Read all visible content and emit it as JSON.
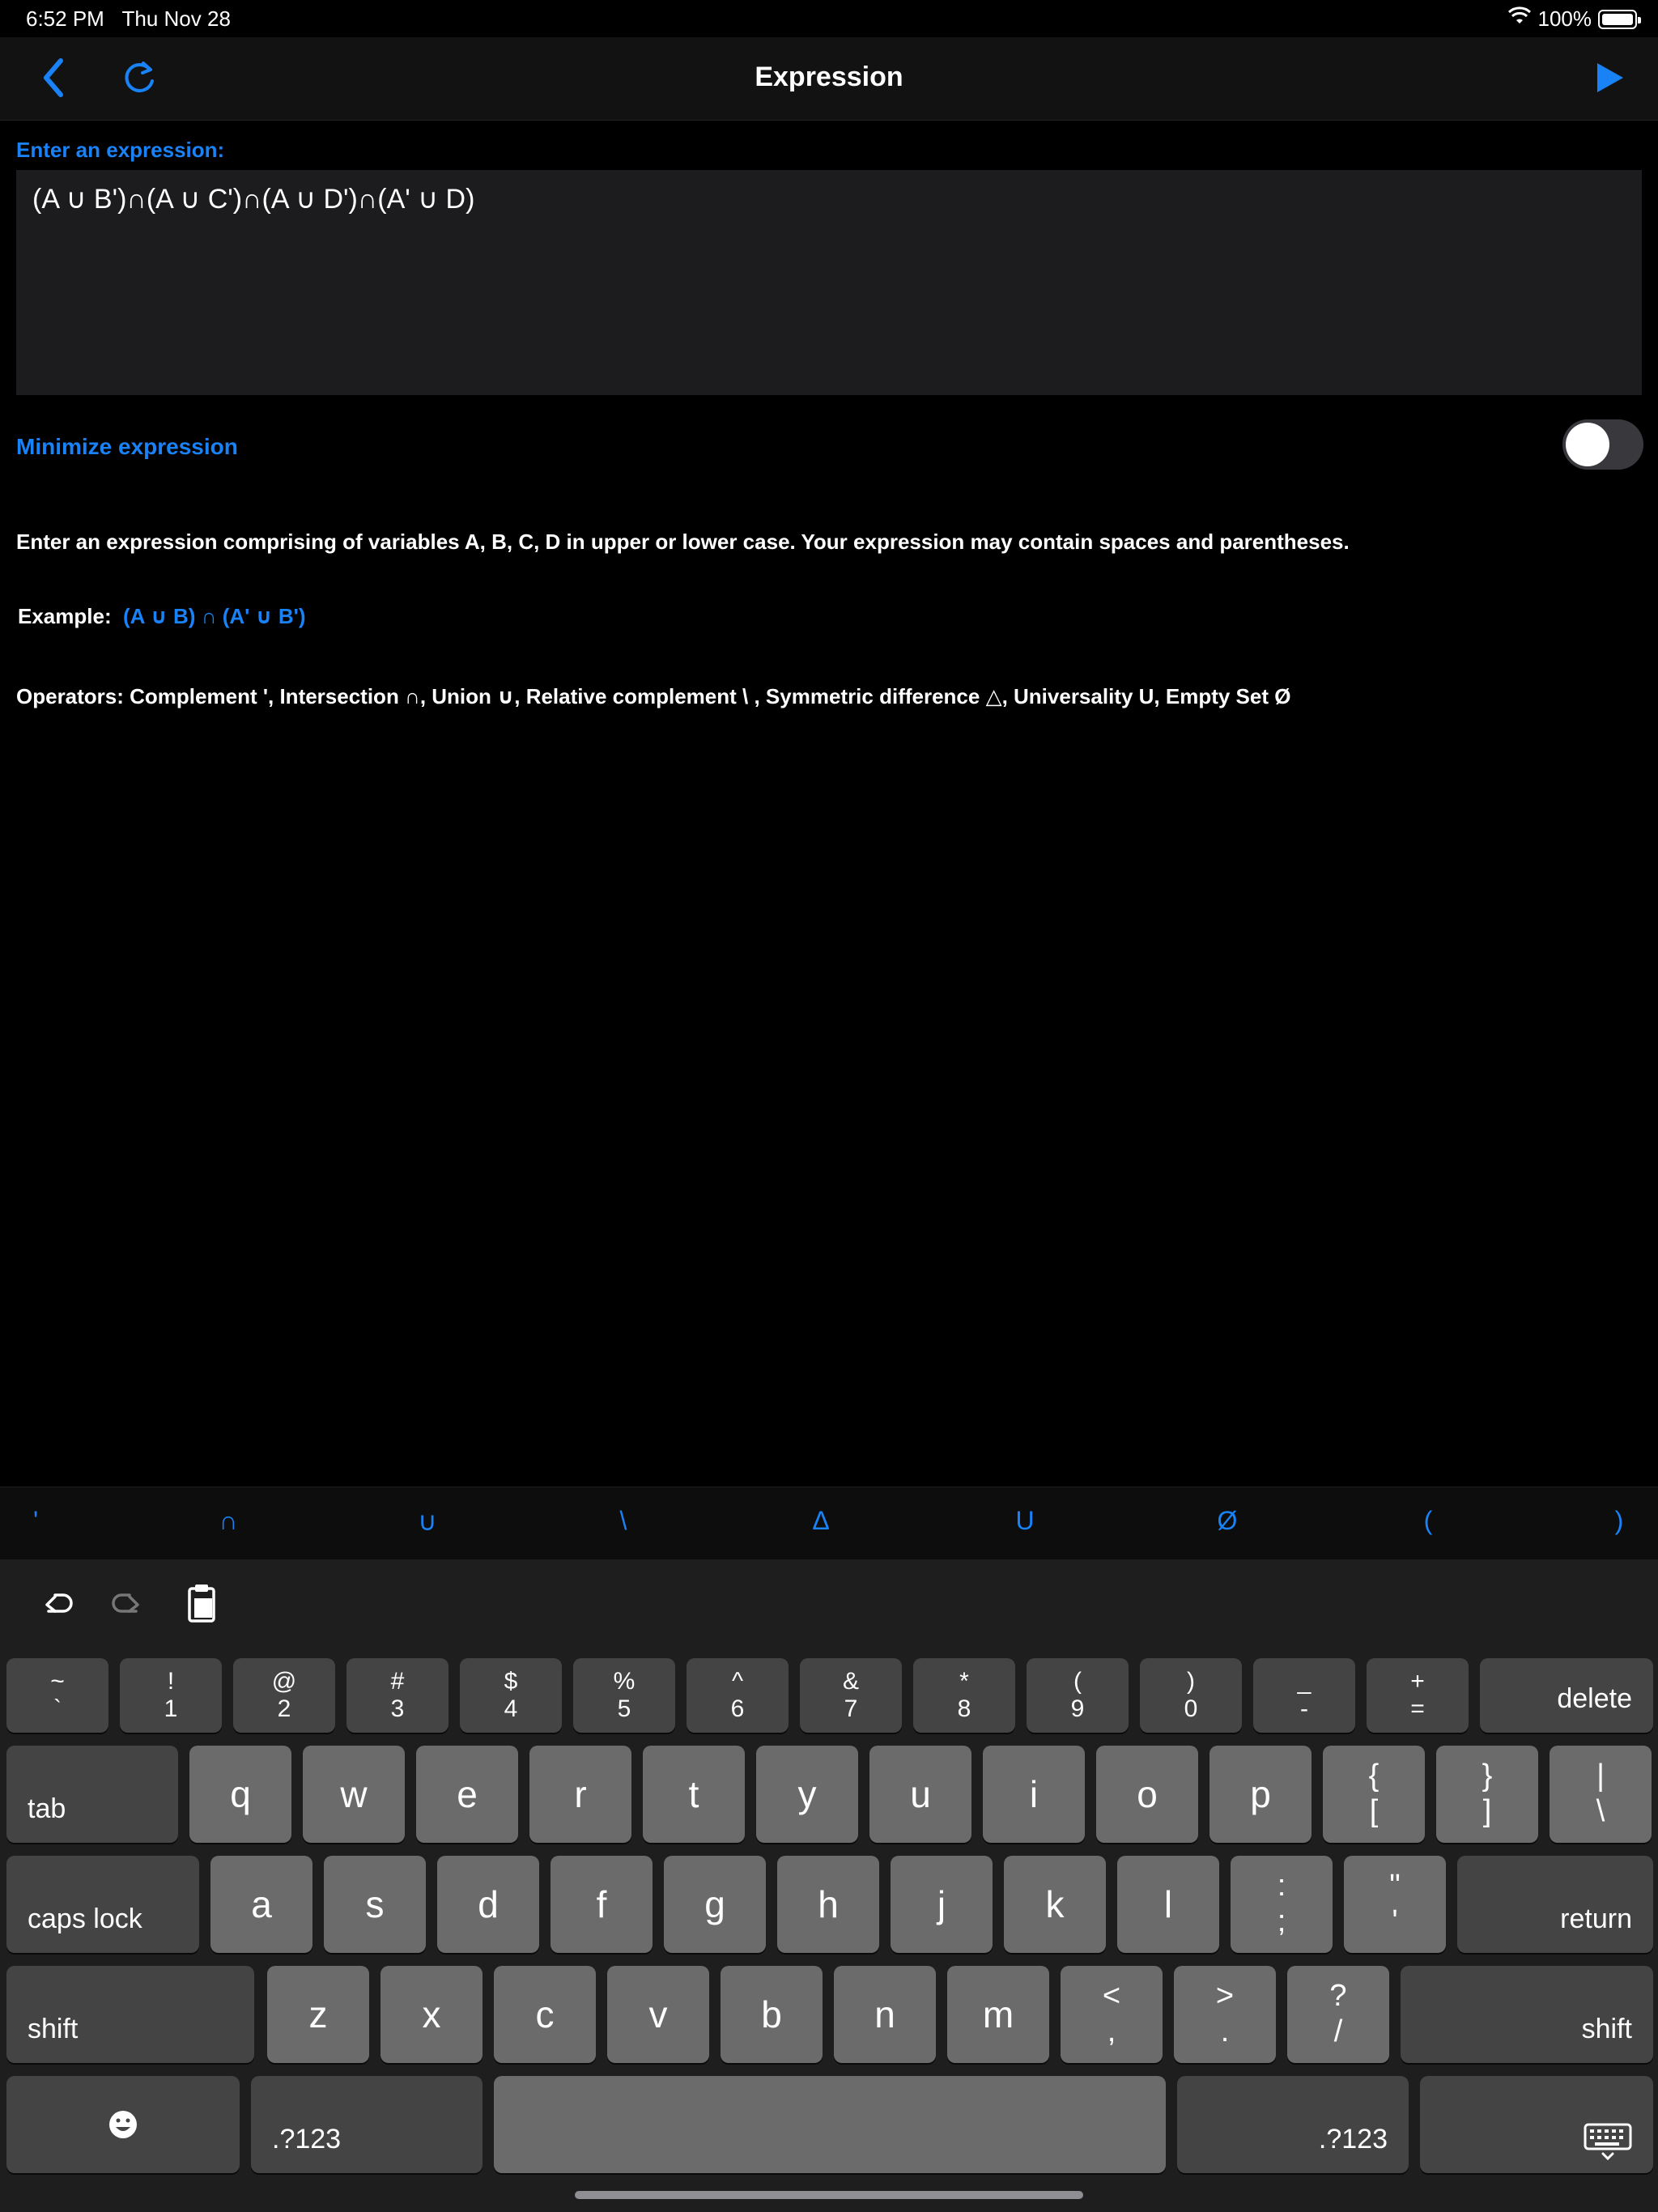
{
  "status_bar": {
    "time": "6:52 PM",
    "date": "Thu Nov 28",
    "battery": "100%"
  },
  "nav": {
    "title": "Expression"
  },
  "expression": {
    "label": "Enter an expression:",
    "value": "(A ∪ B')∩(A ∪ C')∩(A ∪ D')∩(A' ∪ D)"
  },
  "minimize": {
    "label": "Minimize expression",
    "on": false
  },
  "help": {
    "text": "Enter an expression comprising of variables A, B, C, D in upper or lower case. Your expression may contain spaces and parentheses.",
    "example_label": "Example:",
    "example_value": "(A ∪ B) ∩ (A' ∪ B')",
    "operators": "Operators: Complement ', Intersection ∩, Union ∪, Relative complement \\ , Symmetric difference △, Universality U, Empty Set Ø"
  },
  "operator_bar": [
    "'",
    "∩",
    "∪",
    "\\",
    "Δ",
    "U",
    "Ø",
    "(",
    ")"
  ],
  "keyboard": {
    "number_row": [
      {
        "top": "~",
        "bottom": "`"
      },
      {
        "top": "!",
        "bottom": "1"
      },
      {
        "top": "@",
        "bottom": "2"
      },
      {
        "top": "#",
        "bottom": "3"
      },
      {
        "top": "$",
        "bottom": "4"
      },
      {
        "top": "%",
        "bottom": "5"
      },
      {
        "top": "^",
        "bottom": "6"
      },
      {
        "top": "&",
        "bottom": "7"
      },
      {
        "top": "*",
        "bottom": "8"
      },
      {
        "top": "(",
        "bottom": "9"
      },
      {
        "top": ")",
        "bottom": "0"
      },
      {
        "top": "_",
        "bottom": "-"
      },
      {
        "top": "+",
        "bottom": "="
      }
    ],
    "row1": [
      "q",
      "w",
      "e",
      "r",
      "t",
      "y",
      "u",
      "i",
      "o",
      "p"
    ],
    "row1_extra": [
      {
        "top": "{",
        "bottom": "["
      },
      {
        "top": "}",
        "bottom": "]"
      },
      {
        "top": "|",
        "bottom": "\\"
      }
    ],
    "row2": [
      "a",
      "s",
      "d",
      "f",
      "g",
      "h",
      "j",
      "k",
      "l"
    ],
    "row2_extra": [
      {
        "top": ":",
        "bottom": ";"
      },
      {
        "top": "\"",
        "bottom": "'"
      }
    ],
    "row3": [
      "z",
      "x",
      "c",
      "v",
      "b",
      "n",
      "m"
    ],
    "row3_extra": [
      {
        "top": "<",
        "bottom": ","
      },
      {
        "top": ">",
        "bottom": "."
      },
      {
        "top": "?",
        "bottom": "/"
      }
    ],
    "delete": "delete",
    "tab": "tab",
    "caps_lock": "caps lock",
    "return": "return",
    "shift": "shift",
    "numbers_left": ".?123",
    "numbers_right": ".?123",
    "emoji_icon": "emoji-icon",
    "hide_keyboard_icon": "keyboard-dismiss-icon"
  },
  "colors": {
    "accent": "#1a82f7",
    "background": "#000000",
    "key": "#6b6b6b",
    "key_dark": "#444444"
  }
}
